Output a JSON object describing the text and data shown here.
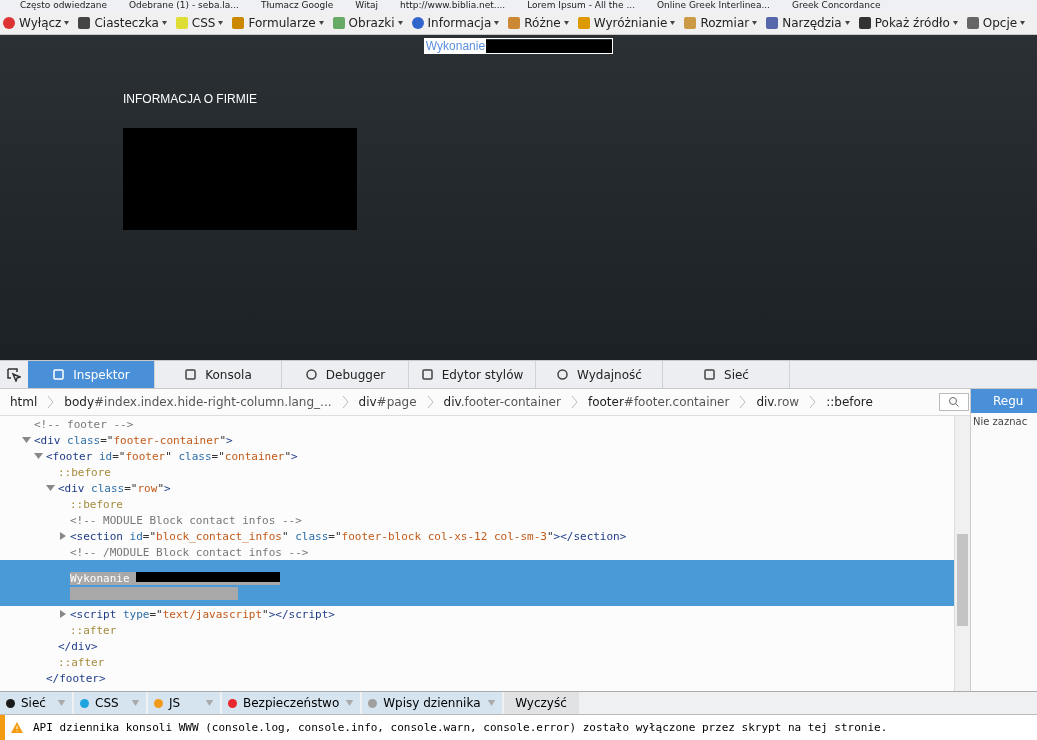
{
  "bookmarks": [
    "Często odwiedzane",
    "Odebrane (1) - seba.la...",
    "Tłumacz Google",
    "Witaj",
    "http://www.biblia.net....",
    "Lorem Ipsum - All the ...",
    "Online Greek Interlinea...",
    "Greek Concordance"
  ],
  "toolbar": [
    "Wyłącz",
    "Ciasteczka",
    "CSS",
    "Formularze",
    "Obrazki",
    "Informacja",
    "Różne",
    "Wyróżnianie",
    "Rozmiar",
    "Narzędzia",
    "Pokaż źródło",
    "Opcje"
  ],
  "page": {
    "footer_link": "Wykonanie",
    "heading": "INFORMACJA O FIRMIE"
  },
  "devtools": {
    "tabs": [
      {
        "label": "Inspektor",
        "selected": true
      },
      {
        "label": "Konsola",
        "selected": false
      },
      {
        "label": "Debugger",
        "selected": false
      },
      {
        "label": "Edytor stylów",
        "selected": false
      },
      {
        "label": "Wydajność",
        "selected": false
      },
      {
        "label": "Sieć",
        "selected": false
      }
    ],
    "breadcrumbs": [
      {
        "tag": "html"
      },
      {
        "tag": "body",
        "rest": "#index.index.hide-right-column.lang_..."
      },
      {
        "tag": "div",
        "rest": "#page"
      },
      {
        "tag": "div",
        "rest": ".footer-container"
      },
      {
        "tag": "footer",
        "rest": "#footer.container"
      },
      {
        "tag": "div",
        "rest": ".row"
      },
      {
        "tag": "::before"
      }
    ],
    "markup": [
      {
        "kind": "comment",
        "text": "<!-- footer -->",
        "selected": false
      },
      {
        "kind": "element",
        "selected": false,
        "expanded": true,
        "open": [
          {
            "kind": "tag",
            "text": "<div"
          },
          {
            "kind": "attr",
            "text": " class"
          },
          {
            "kind": "punct",
            "text": "=\""
          },
          {
            "kind": "value",
            "text": "footer-container"
          },
          {
            "kind": "punct",
            "text": "\""
          },
          {
            "kind": "tag",
            "text": ">"
          }
        ],
        "children": [
          {
            "kind": "element",
            "selected": false,
            "expanded": true,
            "close": "</footer>",
            "open": [
              {
                "kind": "tag",
                "text": "<footer"
              },
              {
                "kind": "attr",
                "text": " id"
              },
              {
                "kind": "punct",
                "text": "=\""
              },
              {
                "kind": "value",
                "text": "footer"
              },
              {
                "kind": "punct",
                "text": "\""
              },
              {
                "kind": "attr",
                "text": " class"
              },
              {
                "kind": "punct",
                "text": "=\""
              },
              {
                "kind": "value",
                "text": "container"
              },
              {
                "kind": "punct",
                "text": "\""
              },
              {
                "kind": "tag",
                "text": ">"
              }
            ],
            "children": [
              {
                "kind": "pseudo",
                "text": "::before",
                "selected": false
              },
              {
                "kind": "element",
                "selected": false,
                "expanded": true,
                "close": "</div>",
                "open": [
                  {
                    "kind": "tag",
                    "text": "<div"
                  },
                  {
                    "kind": "attr",
                    "text": " class"
                  },
                  {
                    "kind": "punct",
                    "text": "=\""
                  },
                  {
                    "kind": "value",
                    "text": "row"
                  },
                  {
                    "kind": "punct",
                    "text": "\""
                  },
                  {
                    "kind": "tag",
                    "text": ">"
                  }
                ],
                "children": [
                  {
                    "kind": "pseudo",
                    "text": "::before",
                    "selected": false
                  },
                  {
                    "kind": "comment",
                    "text": "<!-- MODULE Block contact infos -->",
                    "selected": false
                  },
                  {
                    "kind": "element",
                    "selected": false,
                    "expanded": false,
                    "open": [
                      {
                        "kind": "tag",
                        "text": "<section"
                      },
                      {
                        "kind": "attr",
                        "text": " id"
                      },
                      {
                        "kind": "punct",
                        "text": "=\""
                      },
                      {
                        "kind": "value",
                        "text": "block_contact_infos"
                      },
                      {
                        "kind": "punct",
                        "text": "\""
                      },
                      {
                        "kind": "attr",
                        "text": " class"
                      },
                      {
                        "kind": "punct",
                        "text": "=\""
                      },
                      {
                        "kind": "value",
                        "text": "footer-block col-xs-12 col-sm-3"
                      },
                      {
                        "kind": "punct",
                        "text": "\""
                      },
                      {
                        "kind": "tag",
                        "text": "></section>"
                      }
                    ]
                  },
                  {
                    "kind": "comment",
                    "text": "<!-- /MODULE Block contact infos -->",
                    "selected": false
                  },
                  {
                    "kind": "text",
                    "text": "Wykonanie",
                    "selected": true
                  },
                  {
                    "kind": "element",
                    "selected": false,
                    "expanded": false,
                    "open": [
                      {
                        "kind": "tag",
                        "text": "<script"
                      },
                      {
                        "kind": "attr",
                        "text": " type"
                      },
                      {
                        "kind": "punct",
                        "text": "=\""
                      },
                      {
                        "kind": "value",
                        "text": "text/javascript"
                      },
                      {
                        "kind": "punct",
                        "text": "\""
                      },
                      {
                        "kind": "tag",
                        "text": "></script>"
                      }
                    ]
                  },
                  {
                    "kind": "pseudo",
                    "text": "::after",
                    "selected": false
                  }
                ]
              },
              {
                "kind": "pseudo",
                "text": "::after",
                "selected": false
              }
            ]
          }
        ]
      }
    ],
    "side_panel": {
      "header": "Regu",
      "text": "Nie zaznac"
    }
  },
  "console": {
    "filters": [
      {
        "label": "Sieć",
        "color": "#1a1a1a",
        "menu": true
      },
      {
        "label": "CSS",
        "color": "#1ea5e0",
        "menu": true
      },
      {
        "label": "JS",
        "color": "#f29a1c",
        "menu": true
      },
      {
        "label": "Bezpieczeństwo",
        "color": "#e8272e",
        "menu": true
      },
      {
        "label": "Wpisy dziennika",
        "color": "#a0a0a0",
        "menu": true
      },
      {
        "label": "Wyczyść",
        "menu": false
      }
    ],
    "message": "API dziennika konsoli WWW (console.log, console.info, console.warn, console.error) zostało wyłączone przez skrypt na tej stronie."
  }
}
